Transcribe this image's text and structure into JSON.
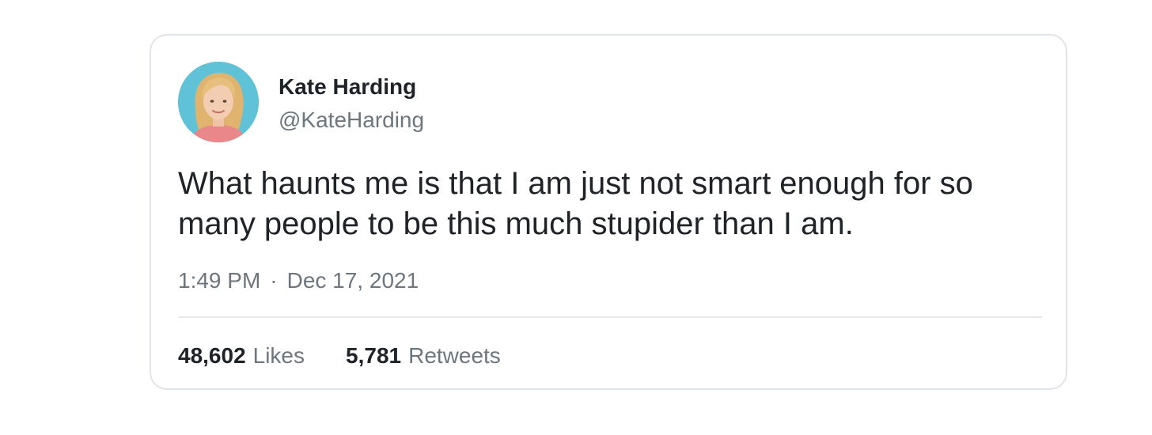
{
  "tweet": {
    "author": {
      "name": "Kate Harding",
      "handle": "@KateHarding",
      "avatar_icon": "profile-photo"
    },
    "text": "What haunts me is that I am just not smart enough for so many people to be this much stupider than I am.",
    "time": "1:49 PM",
    "separator": "·",
    "date": "Dec 17, 2021",
    "stats": {
      "likes_count": "48,602",
      "likes_label": "Likes",
      "retweets_count": "5,781",
      "retweets_label": "Retweets"
    }
  },
  "colors": {
    "card_border": "#e1e4e8",
    "primary_text": "#1f2328",
    "secondary_text": "#6e767d",
    "avatar_bg": "#5fc2d6"
  }
}
